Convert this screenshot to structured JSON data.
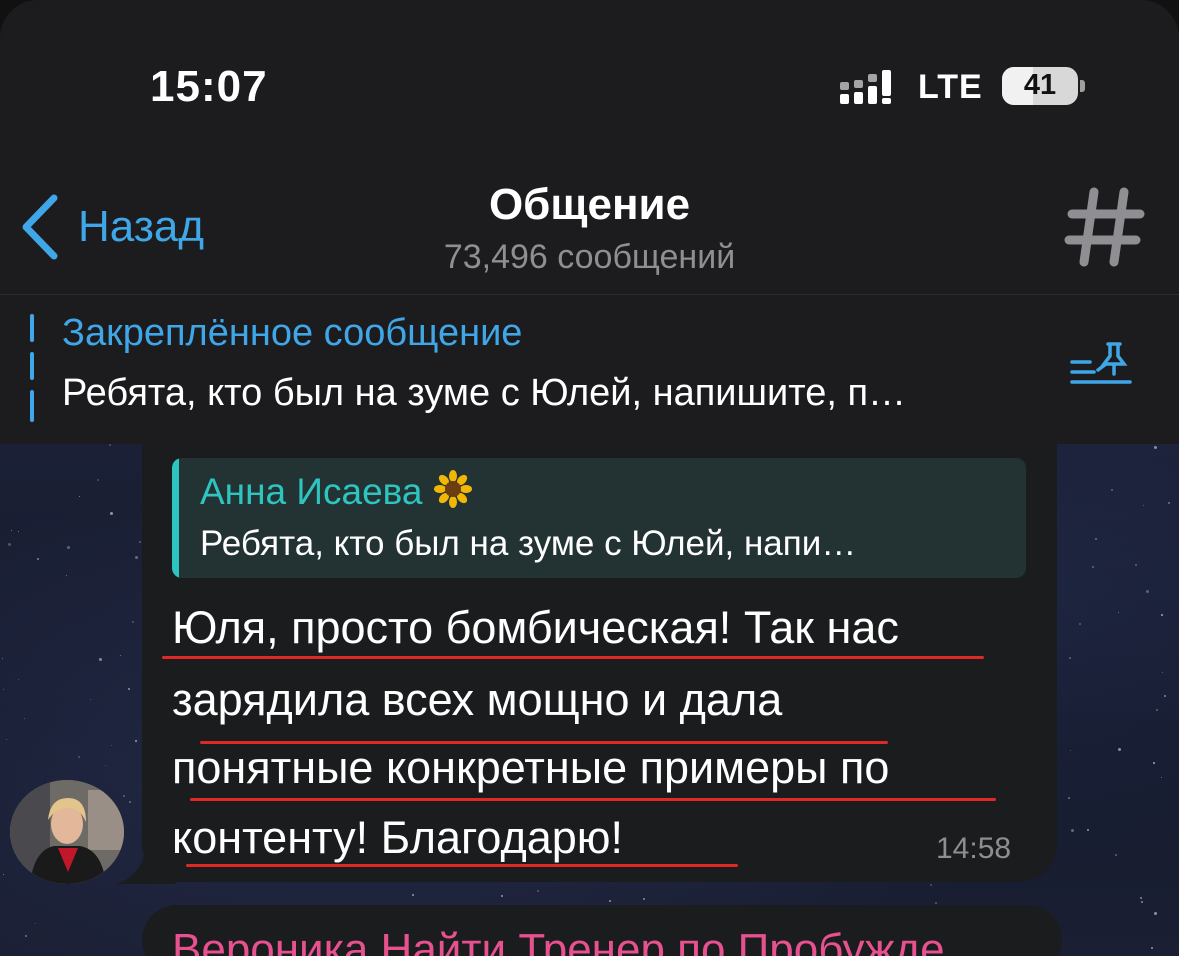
{
  "status_bar": {
    "time": "15:07",
    "network": "LTE",
    "battery": "41",
    "battery_level_percent": 41
  },
  "header": {
    "back_label": "Назад",
    "title": "Общение",
    "subtitle": "73,496 сообщений",
    "hash_icon": "hash-icon"
  },
  "pinned": {
    "title": "Закреплённое сообщение",
    "text": "Ребята, кто был на зуме с Юлей, напишите, п…",
    "icon": "pinned-list-icon"
  },
  "message": {
    "reply": {
      "author": "Анна Исаева",
      "author_emoji_icon": "sunflower-icon",
      "text": "Ребята, кто был на зуме с Юлей, напи…"
    },
    "lines": [
      "Юля, просто бомбическая! Так нас",
      "зарядила всех мощно и дала",
      "понятные конкретные примеры по",
      "контенту! Благодарю!"
    ],
    "time": "14:58"
  },
  "next_message": {
    "author": "Вероника Найти Тренер по Пробужде…"
  },
  "colors": {
    "accent": "#3fa6e8",
    "reply_accent": "#2ec4c0",
    "underline": "#e02828",
    "next_author": "#e8518f"
  }
}
